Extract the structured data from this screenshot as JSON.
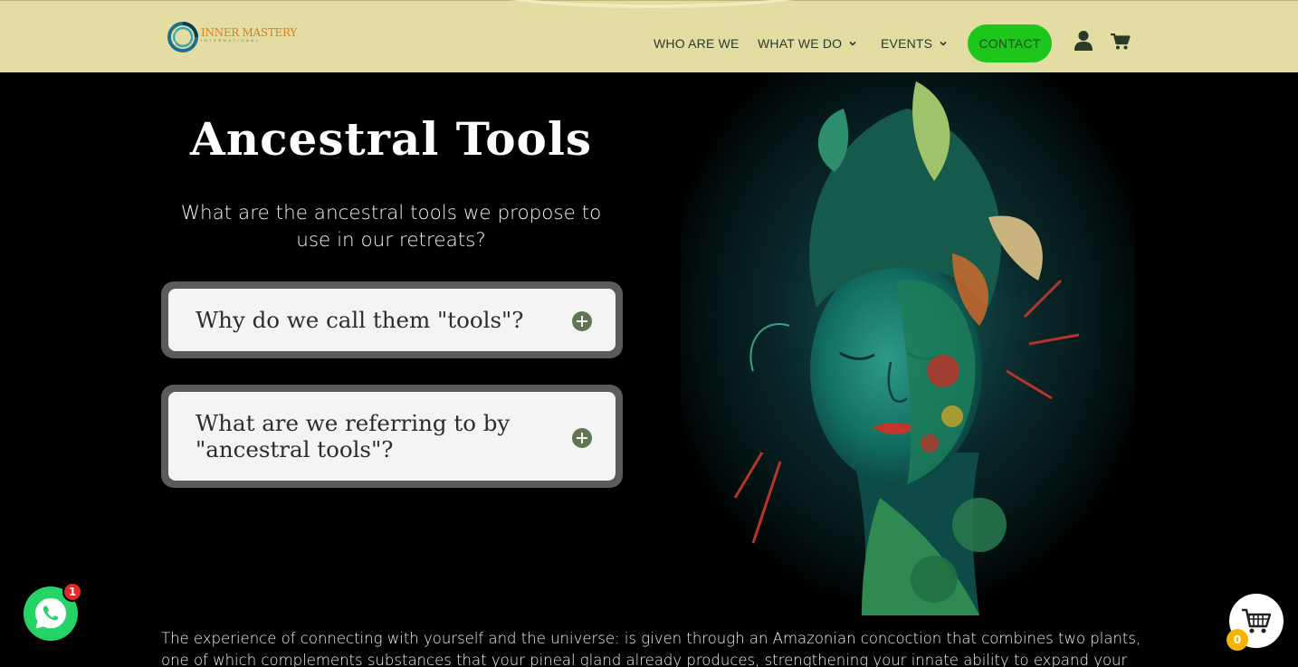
{
  "header": {
    "logo": {
      "name": "INNER MASTERY",
      "sub": "INTERNATIONAL"
    },
    "nav": [
      {
        "label": "WHO ARE WE"
      },
      {
        "label": "WHAT WE DO"
      },
      {
        "label": "EVENTS"
      }
    ],
    "contact_label": "CONTACT",
    "icons": [
      "user-icon",
      "cart-icon",
      "chevron-down-icon"
    ],
    "colors": {
      "header_bg": "#e3dda4",
      "contact_bg": "#1dc61b",
      "nav_text": "#2a3a28"
    }
  },
  "main": {
    "title": "Ancestral Tools",
    "subtitle": "What are the ancestral tools we propose to use in our retreats?",
    "accordion": [
      {
        "label": "Why do we call them \"tools\"?"
      },
      {
        "label": "What are we referring to by \"ancestral tools\"?"
      }
    ],
    "body_text": "The experience of connecting with yourself and the universe: is given through an Amazonian concoction that combines two plants, one of which complements substances that your pineal gland already produces, strengthening your innate ability to expand your consciousness and"
  },
  "floating": {
    "whatsapp_badge": "1",
    "cart_count": "0",
    "colors": {
      "whatsapp": "#25d366",
      "badge": "#e3282a",
      "cart_count_bg": "#f4b400"
    }
  }
}
